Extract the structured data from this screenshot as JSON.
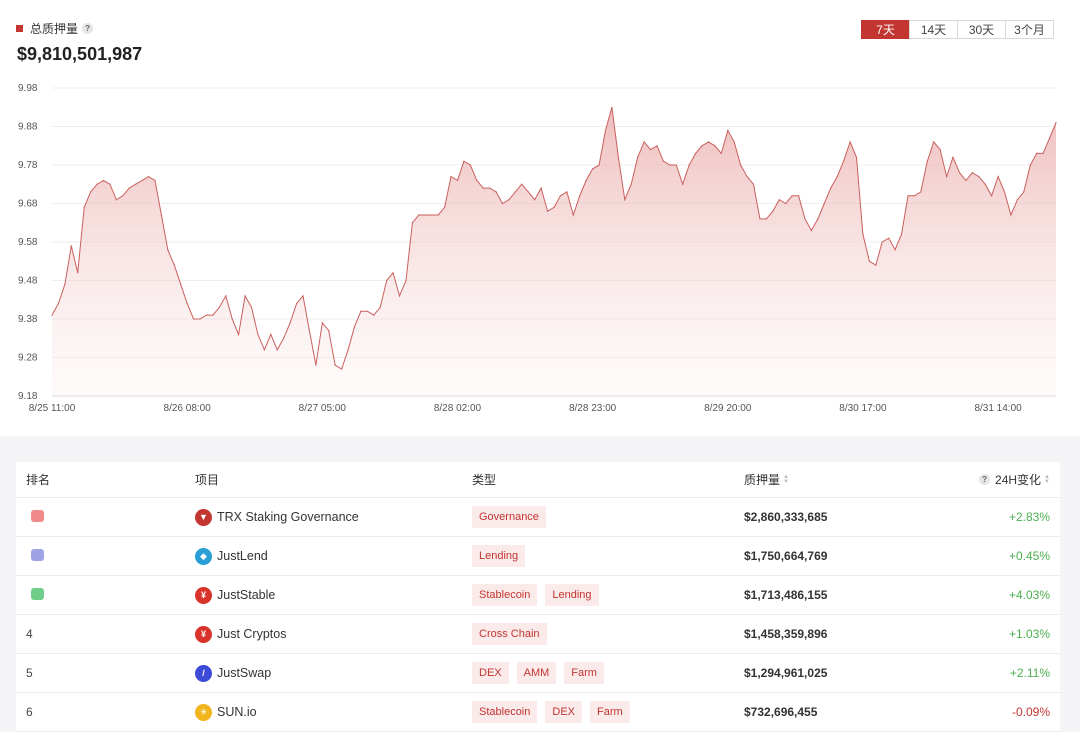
{
  "header": {
    "tvl_label": "总质押量",
    "help_glyph": "?",
    "tvl_value": "$9,810,501,987"
  },
  "period_tabs": [
    {
      "label": "7天",
      "active": true
    },
    {
      "label": "14天",
      "active": false
    },
    {
      "label": "30天",
      "active": false
    },
    {
      "label": "3个月",
      "active": false
    }
  ],
  "colors": {
    "accent": "#c23531",
    "positive": "#4caf50",
    "negative": "#c23531",
    "tag_bg": "#fbeaea"
  },
  "chart_data": {
    "type": "area",
    "y_unit": "B",
    "ylim": [
      9.18,
      9.98
    ],
    "y_ticks": [
      "9.98",
      "9.88",
      "9.78",
      "9.68",
      "9.58",
      "9.48",
      "9.38",
      "9.28",
      "9.18"
    ],
    "x_ticks": [
      "8/25 11:00",
      "8/26 08:00",
      "8/27 05:00",
      "8/28 02:00",
      "8/28 23:00",
      "8/29 20:00",
      "8/30 17:00",
      "8/31 14:00"
    ],
    "x_start": "8/25 11:00",
    "interval_hours": 1,
    "values": [
      9.39,
      9.42,
      9.47,
      9.57,
      9.5,
      9.67,
      9.71,
      9.73,
      9.74,
      9.73,
      9.69,
      9.7,
      9.72,
      9.73,
      9.74,
      9.75,
      9.74,
      9.65,
      9.56,
      9.52,
      9.47,
      9.42,
      9.38,
      9.38,
      9.39,
      9.39,
      9.41,
      9.44,
      9.38,
      9.34,
      9.44,
      9.41,
      9.34,
      9.3,
      9.34,
      9.3,
      9.33,
      9.37,
      9.42,
      9.44,
      9.35,
      9.26,
      9.37,
      9.35,
      9.26,
      9.25,
      9.3,
      9.36,
      9.4,
      9.4,
      9.39,
      9.41,
      9.48,
      9.5,
      9.44,
      9.48,
      9.63,
      9.65,
      9.65,
      9.65,
      9.65,
      9.67,
      9.75,
      9.74,
      9.79,
      9.78,
      9.74,
      9.72,
      9.72,
      9.71,
      9.68,
      9.69,
      9.71,
      9.73,
      9.71,
      9.69,
      9.72,
      9.66,
      9.67,
      9.7,
      9.71,
      9.65,
      9.7,
      9.74,
      9.77,
      9.78,
      9.87,
      9.93,
      9.8,
      9.69,
      9.73,
      9.8,
      9.84,
      9.82,
      9.83,
      9.79,
      9.78,
      9.78,
      9.73,
      9.78,
      9.81,
      9.83,
      9.84,
      9.83,
      9.81,
      9.87,
      9.84,
      9.78,
      9.75,
      9.73,
      9.64,
      9.64,
      9.66,
      9.69,
      9.68,
      9.7,
      9.7,
      9.64,
      9.61,
      9.64,
      9.68,
      9.72,
      9.75,
      9.79,
      9.84,
      9.8,
      9.6,
      9.53,
      9.52,
      9.58,
      9.59,
      9.56,
      9.6,
      9.7,
      9.7,
      9.71,
      9.79,
      9.84,
      9.82,
      9.75,
      9.8,
      9.76,
      9.74,
      9.76,
      9.75,
      9.73,
      9.7,
      9.75,
      9.71,
      9.65,
      9.69,
      9.71,
      9.78,
      9.81,
      9.81,
      9.85,
      9.89
    ]
  },
  "table": {
    "headers": {
      "rank": "排名",
      "project": "项目",
      "type": "类型",
      "tvl": "质押量",
      "change": "24H变化",
      "change_help": "?"
    },
    "rows": [
      {
        "rank": "",
        "medal": "gold",
        "name": "TRX Staking Governance",
        "logo_color": "#c23531",
        "logo_glyph": "▼",
        "tags": [
          "Governance"
        ],
        "tvl": "$2,860,333,685",
        "change": "+2.83%",
        "trend": "pos"
      },
      {
        "rank": "",
        "medal": "silver",
        "name": "JustLend",
        "logo_color": "#2a9fd6",
        "logo_glyph": "◆",
        "tags": [
          "Lending"
        ],
        "tvl": "$1,750,664,769",
        "change": "+0.45%",
        "trend": "pos"
      },
      {
        "rank": "",
        "medal": "bronze",
        "name": "JustStable",
        "logo_color": "#d9342b",
        "logo_glyph": "¥",
        "tags": [
          "Stablecoin",
          "Lending"
        ],
        "tvl": "$1,713,486,155",
        "change": "+4.03%",
        "trend": "pos"
      },
      {
        "rank": "4",
        "medal": "",
        "name": "Just Cryptos",
        "logo_color": "#d9342b",
        "logo_glyph": "¥",
        "tags": [
          "Cross Chain"
        ],
        "tvl": "$1,458,359,896",
        "change": "+1.03%",
        "trend": "pos"
      },
      {
        "rank": "5",
        "medal": "",
        "name": "JustSwap",
        "logo_color": "#3b4bd8",
        "logo_glyph": "/",
        "tags": [
          "DEX",
          "AMM",
          "Farm"
        ],
        "tvl": "$1,294,961,025",
        "change": "+2.11%",
        "trend": "pos"
      },
      {
        "rank": "6",
        "medal": "",
        "name": "SUN.io",
        "logo_color": "#f2b51d",
        "logo_glyph": "☀",
        "tags": [
          "Stablecoin",
          "DEX",
          "Farm"
        ],
        "tvl": "$732,696,455",
        "change": "-0.09%",
        "trend": "neg"
      }
    ]
  }
}
